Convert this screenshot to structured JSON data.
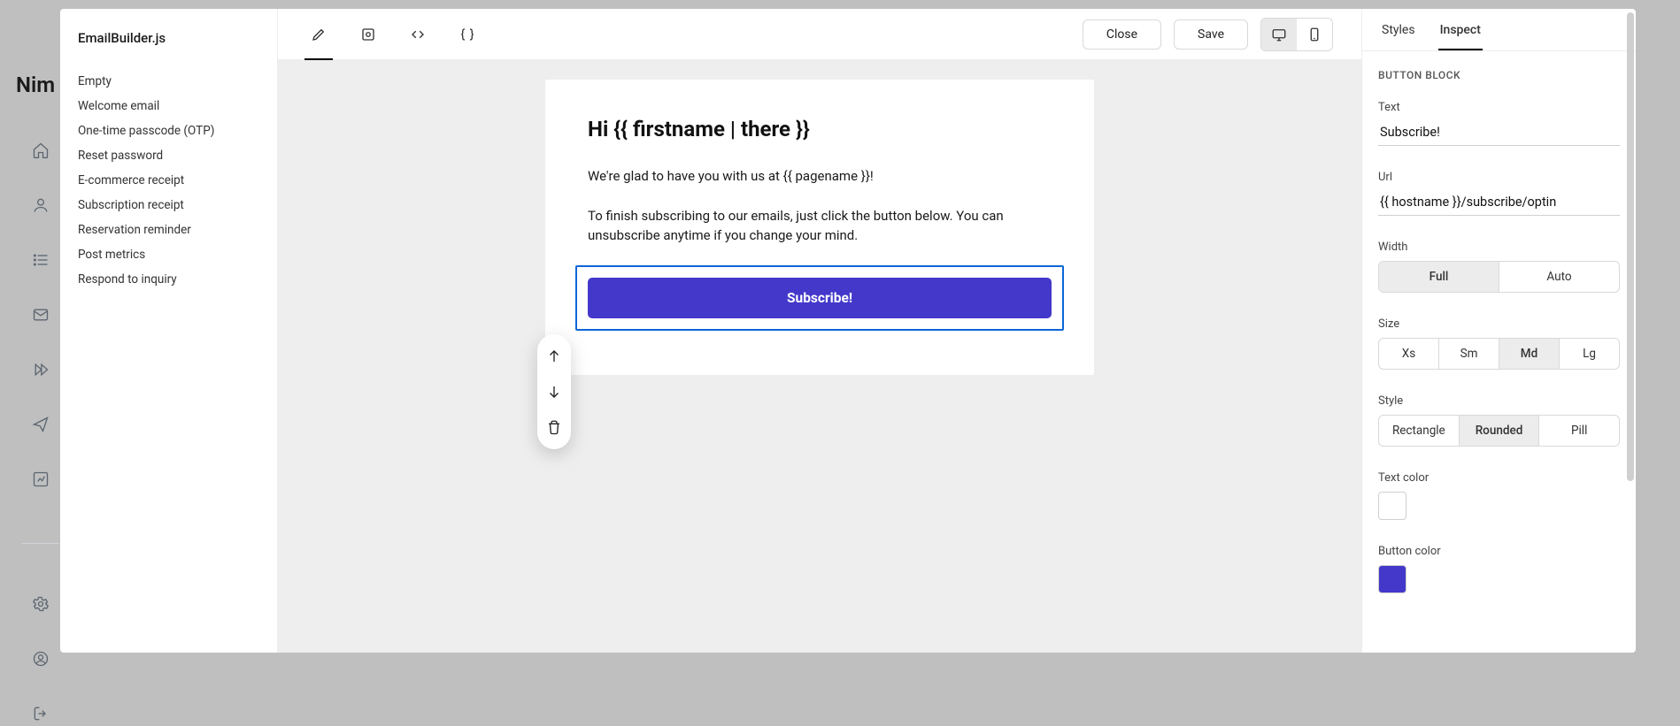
{
  "brand": "Nim",
  "sidebar": {
    "title": "EmailBuilder.js",
    "templates": [
      "Empty",
      "Welcome email",
      "One-time passcode (OTP)",
      "Reset password",
      "E-commerce receipt",
      "Subscription receipt",
      "Reservation reminder",
      "Post metrics",
      "Respond to inquiry"
    ]
  },
  "toolbar": {
    "close": "Close",
    "save": "Save"
  },
  "email": {
    "heading": "Hi {{ firstname | there }}",
    "p1": "We're glad to have you with us at {{ pagename }}!",
    "p2": "To finish subscribing to our emails, just click the button below. You can unsubscribe anytime if you change your mind.",
    "button": "Subscribe!"
  },
  "inspector": {
    "tabs": {
      "styles": "Styles",
      "inspect": "Inspect"
    },
    "section": "BUTTON BLOCK",
    "text": {
      "label": "Text",
      "value": "Subscribe!"
    },
    "url": {
      "label": "Url",
      "value": "{{ hostname }}/subscribe/optin"
    },
    "width": {
      "label": "Width",
      "options": [
        "Full",
        "Auto"
      ],
      "active": "Full"
    },
    "size": {
      "label": "Size",
      "options": [
        "Xs",
        "Sm",
        "Md",
        "Lg"
      ],
      "active": "Md"
    },
    "style": {
      "label": "Style",
      "options": [
        "Rectangle",
        "Rounded",
        "Pill"
      ],
      "active": "Rounded"
    },
    "textColor": {
      "label": "Text color",
      "value": "#ffffff"
    },
    "buttonColor": {
      "label": "Button color",
      "value": "#4338ca"
    }
  }
}
